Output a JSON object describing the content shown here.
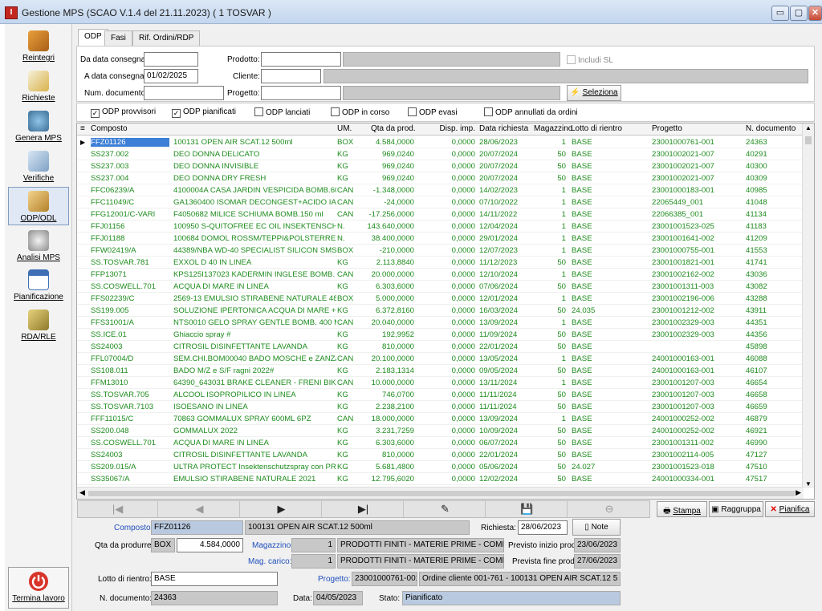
{
  "window": {
    "title": "Gestione MPS (SCAO V.1.4 del 21.11.2023)  ( 1 TOSVAR )",
    "minimize": "▭",
    "maximize": "▢",
    "close": "✕"
  },
  "sidebar": {
    "items": [
      {
        "label": "Reintegri",
        "icon": "boxes-icon"
      },
      {
        "label": "Richieste",
        "icon": "notepad-pencil-icon"
      },
      {
        "label": "Genera MPS",
        "icon": "gears-icon"
      },
      {
        "label": "Verifiche",
        "icon": "pencil-check-icon"
      },
      {
        "label": "ODP/ODL",
        "icon": "clipboard-icon"
      },
      {
        "label": "Analisi MPS",
        "icon": "magnifier-icon"
      },
      {
        "label": "Pianificazione",
        "icon": "calendar-icon"
      },
      {
        "label": "RDA/RLE",
        "icon": "papers-icon"
      }
    ],
    "terminate": "Termina lavoro"
  },
  "tabs": [
    "ODP",
    "Fasi",
    "Rif. Ordini/RDP"
  ],
  "filters": {
    "da_data_label": "Da data consegna:",
    "da_data_value": "",
    "a_data_label": "A data consegna:",
    "a_data_value": "01/02/2025",
    "num_doc_label": "Num. documento:",
    "num_doc_value": "",
    "prodotto_label": "Prodotto:",
    "cliente_label": "Cliente:",
    "progetto_label": "Progetto:",
    "includi_sl": "Includi SL",
    "seleziona": "Seleziona"
  },
  "checks": [
    {
      "label": "ODP provvisori",
      "checked": true
    },
    {
      "label": "ODP pianificati",
      "checked": true
    },
    {
      "label": "ODP lanciati",
      "checked": false
    },
    {
      "label": "ODP in corso",
      "checked": false
    },
    {
      "label": "ODP evasi",
      "checked": false
    },
    {
      "label": "ODP annullati da ordini",
      "checked": false
    }
  ],
  "grid": {
    "headers": [
      "Composto",
      "UM.",
      "Qta da prod.",
      "Disp. imp.",
      "Data richiesta",
      "Magazzino",
      "Lotto di rientro",
      "Progetto",
      "N. documento"
    ],
    "rows": [
      [
        "FFZ01126",
        "100131 OPEN AIR SCAT.12 500ml",
        "BOX",
        "4.584,0000",
        "0,0000",
        "28/06/2023",
        "1",
        "BASE",
        "23001000761-001",
        "24363"
      ],
      [
        "SS237.002",
        "DEO DONNA DELICATO",
        "KG",
        "969,0240",
        "0,0000",
        "20/07/2024",
        "50",
        "BASE",
        "23001002021-007",
        "40291"
      ],
      [
        "SS237.003",
        "DEO DONNA INVISIBLE",
        "KG",
        "969,0240",
        "0,0000",
        "20/07/2024",
        "50",
        "BASE",
        "23001002021-007",
        "40300"
      ],
      [
        "SS237.004",
        "DEO DONNA DRY FRESH",
        "KG",
        "969,0240",
        "0,0000",
        "20/07/2024",
        "50",
        "BASE",
        "23001002021-007",
        "40309"
      ],
      [
        "FFC06239/A",
        "4100004A CASA JARDIN VESPICIDA BOMB.600ml",
        "CAN",
        "-1.348,0000",
        "0,0000",
        "14/02/2023",
        "1",
        "BASE",
        "23001000183-001",
        "40985"
      ],
      [
        "FFC11049/C",
        "GA1360400 ISOMAR DECONGEST+ACIDO IALURO",
        "CAN",
        "-24,0000",
        "0,0000",
        "07/10/2022",
        "1",
        "BASE",
        "22065449_001",
        "41048"
      ],
      [
        "FFG12001/C-VARI",
        "F4050682 MILICE SCHIUMA BOMB.150 ml",
        "CAN",
        "-17.256,0000",
        "0,0000",
        "14/11/2022",
        "1",
        "BASE",
        "22066385_001",
        "41134"
      ],
      [
        "FFJ01156",
        "100950 S-QUITOFREE EC OIL INSEKTENSCHUTZSP",
        "N.",
        "143.640,0000",
        "0,0000",
        "12/04/2024",
        "1",
        "BASE",
        "23001001523-025",
        "41183"
      ],
      [
        "FFJ01188",
        "100684 DOMOL ROSSM/TEPPI&POLSTERREINIGER",
        "N.",
        "38.400,0000",
        "0,0000",
        "29/01/2024",
        "1",
        "BASE",
        "23001001641-002",
        "41209"
      ],
      [
        "FFW02419/A",
        "44389/NBA WD-40 SPECIALIST SILICON SMS UK Sc",
        "BOX",
        "-210,0000",
        "0,0000",
        "12/07/2023",
        "1",
        "BASE",
        "23001000755-001",
        "41553"
      ],
      [
        "SS.TOSVAR.781",
        "EXXOL D 40 IN LINEA",
        "KG",
        "2.113,8840",
        "0,0000",
        "11/12/2023",
        "50",
        "BASE",
        "23001001821-001",
        "41741"
      ],
      [
        "FFP13071",
        "KPS125I137023 KADERMIN INGLESE BOMB. 125 m",
        "CAN",
        "20.000,0000",
        "0,0000",
        "12/10/2024",
        "1",
        "BASE",
        "23001002162-002",
        "43036"
      ],
      [
        "SS.COSWELL.701",
        "ACQUA DI MARE IN LINEA",
        "KG",
        "6.303,6000",
        "0,0000",
        "07/06/2024",
        "50",
        "BASE",
        "23001001311-003",
        "43082"
      ],
      [
        "FFS02239/C",
        "2569-13 EMULSIO STIRABENE NATURALE 480 ml -",
        "BOX",
        "5.000,0000",
        "0,0000",
        "12/01/2024",
        "1",
        "BASE",
        "23001002196-006",
        "43288"
      ],
      [
        "SS199.005",
        "SOLUZIONE IPERTONICA ACQUA DI MARE + ACID",
        "KG",
        "6.372,8160",
        "0,0000",
        "16/03/2024",
        "50",
        "24.035",
        "23001001212-002",
        "43911"
      ],
      [
        "FFS31001/A",
        "NTS0010 GELO SPRAY GENTLE BOMB. 400 ML",
        "CAN",
        "20.040,0000",
        "0,0000",
        "13/09/2024",
        "1",
        "BASE",
        "23001002329-003",
        "44351"
      ],
      [
        "SS.ICE.01",
        "Ghiaccio spray #",
        "KG",
        "192,9952",
        "0,0000",
        "11/09/2024",
        "50",
        "BASE",
        "23001002329-003",
        "44356"
      ],
      [
        "SS24003",
        "CITROSIL DISINFETTANTE LAVANDA",
        "KG",
        "810,0000",
        "0,0000",
        "22/01/2024",
        "50",
        "BASE",
        "",
        "45898"
      ],
      [
        "FFL07004/D",
        "SEM.CHI.BOM00040 BADO MOSCHE e ZANZARE BC",
        "CAN",
        "20.100,0000",
        "0,0000",
        "13/05/2024",
        "1",
        "BASE",
        "24001000163-001",
        "46088"
      ],
      [
        "SS108.011",
        "BADO M/Z e S/F ragni 2022#",
        "KG",
        "2.183,1314",
        "0,0000",
        "09/05/2024",
        "50",
        "BASE",
        "24001000163-001",
        "46107"
      ],
      [
        "FFM13010",
        "64390_643031 BRAKE CLEANER - FRENI BIKE E MC",
        "CAN",
        "10.000,0000",
        "0,0000",
        "13/11/2024",
        "1",
        "BASE",
        "23001001207-003",
        "46654"
      ],
      [
        "SS.TOSVAR.705",
        "ALCOOL ISOPROPILICO IN LINEA",
        "KG",
        "746,0700",
        "0,0000",
        "11/11/2024",
        "50",
        "BASE",
        "23001001207-003",
        "46658"
      ],
      [
        "SS.TOSVAR.7103",
        "ISOESANO IN LINEA",
        "KG",
        "2.238,2100",
        "0,0000",
        "11/11/2024",
        "50",
        "BASE",
        "23001001207-003",
        "46659"
      ],
      [
        "FFF11015/C",
        "70863 GOMMALUX SPRAY 600ML 6PZ",
        "CAN",
        "18.000,0000",
        "0,0000",
        "13/09/2024",
        "1",
        "BASE",
        "24001000252-002",
        "46879"
      ],
      [
        "SS200.048",
        "GOMMALUX 2022",
        "KG",
        "3.231,7259",
        "0,0000",
        "10/09/2024",
        "50",
        "BASE",
        "24001000252-002",
        "46921"
      ],
      [
        "SS.COSWELL.701",
        "ACQUA DI MARE IN LINEA",
        "KG",
        "6.303,6000",
        "0,0000",
        "06/07/2024",
        "50",
        "BASE",
        "23001001311-002",
        "46990"
      ],
      [
        "SS24003",
        "CITROSIL DISINFETTANTE LAVANDA",
        "KG",
        "810,0000",
        "0,0000",
        "22/01/2024",
        "50",
        "BASE",
        "23001002114-005",
        "47127"
      ],
      [
        "SS209.015/A",
        "ULTRA PROTECT Insektenschutzspray con PRE-MI",
        "KG",
        "5.681,4800",
        "0,0000",
        "05/06/2024",
        "50",
        "24.027",
        "23001001523-018",
        "47510"
      ],
      [
        "SS35067/A",
        "EMULSIO STIRABENE NATURALE 2021",
        "KG",
        "12.795,6020",
        "0,0000",
        "12/02/2024",
        "50",
        "BASE",
        "24001000334-001",
        "47517"
      ]
    ]
  },
  "nav": {
    "first": "|◀",
    "prev": "◀",
    "next": "▶",
    "last": "▶|",
    "edit": "✎",
    "save": "💾",
    "cancel": "⊖"
  },
  "actions": {
    "stampa": "Stampa",
    "raggruppa": "Raggruppa",
    "pianifica": "Pianifica"
  },
  "detail": {
    "composto_label": "Composto:",
    "composto_code": "FFZ01126",
    "composto_desc": "100131 OPEN AIR SCAT.12 500ml",
    "richiesta_label": "Richiesta:",
    "richiesta_value": "28/06/2023",
    "note": "Note",
    "qta_label": "Qta da produrre:",
    "qta_um": "BOX",
    "qta_value": "4.584,0000",
    "magazzino_label": "Magazzino:",
    "magazzino_num": "1",
    "magazzino_desc": "PRODOTTI FINITI - MATERIE PRIME - COMPONENT",
    "inizio_label": "Previsto inizio prod.:",
    "inizio_value": "23/06/2023",
    "magcar_label": "Mag. carico:",
    "magcar_num": "1",
    "magcar_desc": "PRODOTTI FINITI - MATERIE PRIME - COMPONENT",
    "fine_label": "Prevista fine prod.:",
    "fine_value": "27/06/2023",
    "lotto_label": "Lotto di rientro:",
    "lotto_value": "BASE",
    "progetto_label": "Progetto:",
    "progetto_code": "23001000761-001",
    "progetto_desc": "Ordine cliente 001-761 - 100131 OPEN AIR SCAT.12 5",
    "ndoc_label": "N. documento:",
    "ndoc_value": "24363",
    "data_label": "Data:",
    "data_value": "04/05/2023",
    "stato_label": "Stato:",
    "stato_value": "Pianificato"
  }
}
